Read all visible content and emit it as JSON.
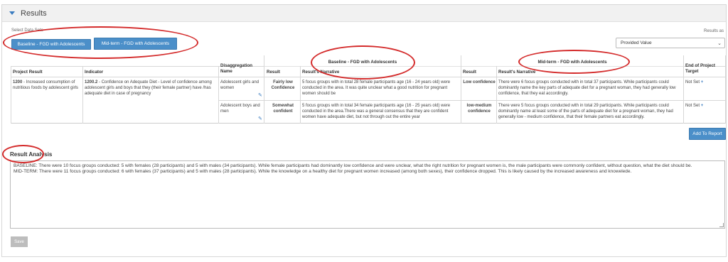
{
  "header": {
    "title": "Results"
  },
  "datasets": {
    "label": "Select Data Sets",
    "buttons": [
      "Baseline - FGD with Adolescents",
      "Mid-term - FGD with Adolescents"
    ]
  },
  "results_as": {
    "label": "Results as",
    "selected": "Provided Value"
  },
  "table": {
    "group_headers": {
      "baseline": "Baseline - FGD with Adolescents",
      "midterm": "Mid-term - FGD with Adolescents"
    },
    "columns": {
      "project_result": "Project Result",
      "indicator": "Indicator",
      "disaggregation": "Disaggregation Name",
      "result": "Result",
      "narrative": "Result's Narrative",
      "end_target": "End of Project Target"
    },
    "project_result": {
      "code": "1200",
      "text": " - Increased consumption of nutritious foods by adolescent girls"
    },
    "indicator": {
      "code": "1200.2",
      "text": " - Confidence on Adequate Diet - Level of confidence among adolescent girls and boys that they (their female partner) have /has adequate diet in case of pregnancy"
    },
    "rows": [
      {
        "disaggregation": "Adolescent girls and women",
        "baseline_result": "Fairly low Confidence",
        "baseline_narrative": "5 focus groups with in total 28 female participants age (16 - 24 years old) were conducted in the area. It was quite unclear what a good nutrition for pregnant women should be",
        "midterm_result": "Low confidence",
        "midterm_narrative": "There were 6 focus groups conducted with in total 37 participants. While participants could dominantly name the key parts of adequate diet for a pregnant woman, they had generally low confidence, that they eat accordingly.",
        "target": "Not Set"
      },
      {
        "disaggregation": "Adolescent boys and men",
        "baseline_result": "Somewhat confident",
        "baseline_narrative": "5 focus groups with in total 34 female participants age (16 - 25 years old) were conducted in the area.There was a general consensus that they are confident women have adequate diet, but not through out the entire year",
        "midterm_result": "low-medium confidence",
        "midterm_narrative": "There were 5 focus groups conducted with in total 29 participants. While participants could dominantly name at least some of the parts of adequate diet for a pregnant woman, they had generally low - medium confidence, that their female partners eat accordingly.",
        "target": "Not Set"
      }
    ]
  },
  "add_to_report": "Add To Report",
  "analysis": {
    "label": "Result Analysis",
    "baseline": "BASELINE: There were 10 focus groups conducted: 5 with females (28 participants) and 5 with males (34 participants). While female participants had dominantly low confidence and were unclear, what the right nutrition for pregnant women is, the male participants were commonly confident, without question, what the diet should be.",
    "midterm": "MID-TERM: There were 11 focus groups conducted: 6 with females (37 participants) and 5 with males (28 participants). While the knowledge on a healthy diet for pregnant women increased (among both sexes), their confidence dropped. This is likely caused by the increased awareness and knowelede."
  },
  "save_label": "Save",
  "colors": {
    "accent": "#4b8fc9",
    "annotation": "#d42b2b"
  }
}
